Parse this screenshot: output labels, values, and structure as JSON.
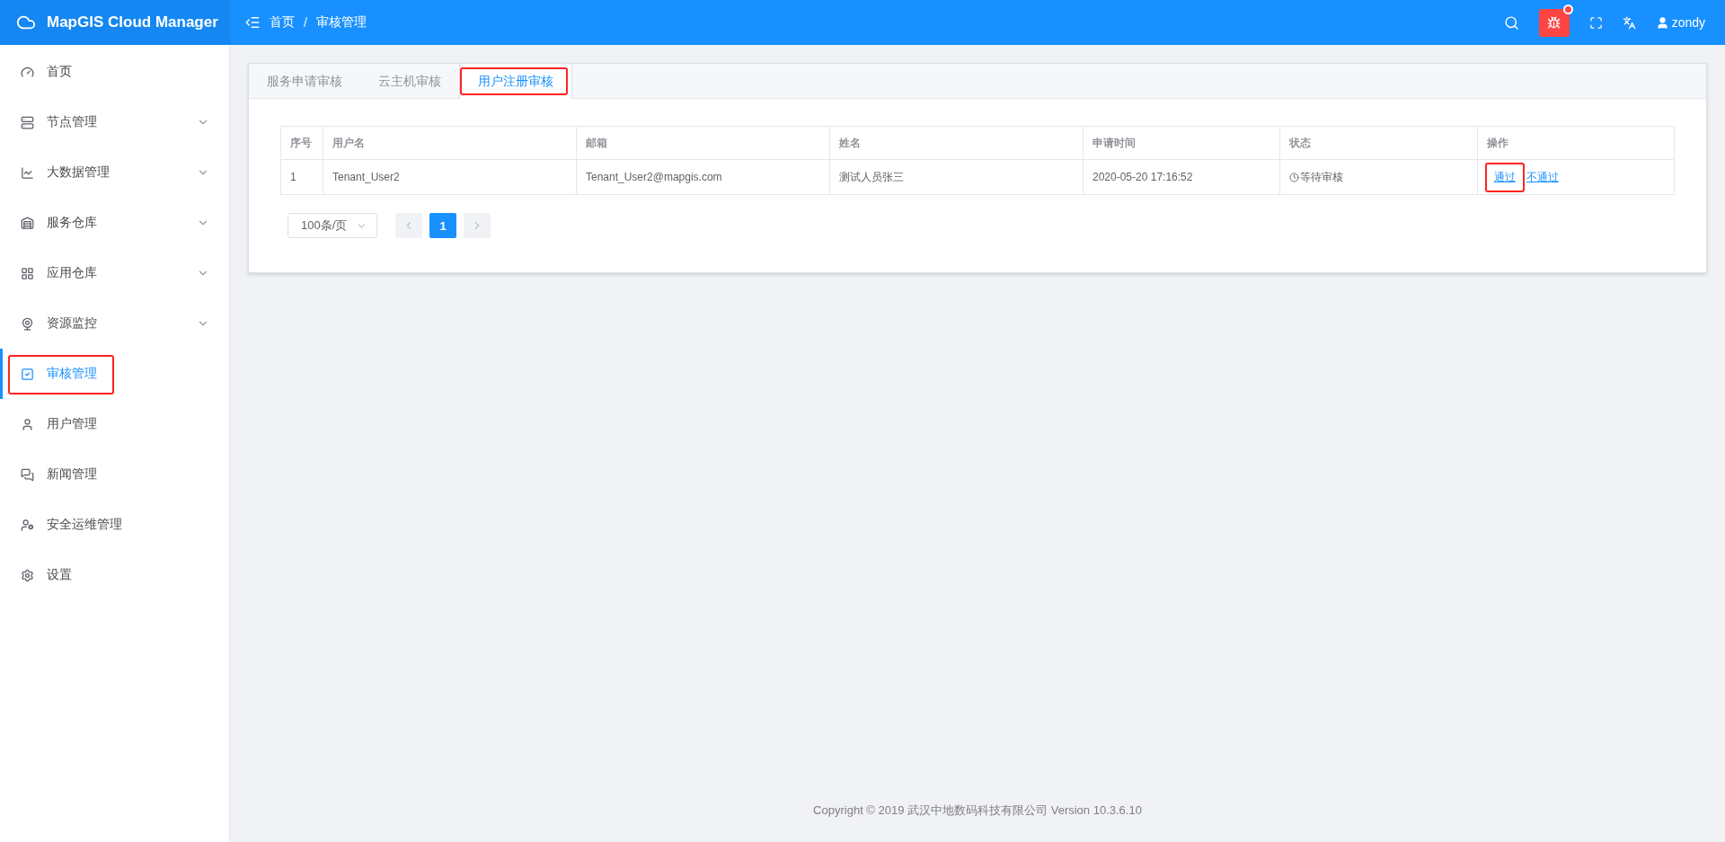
{
  "header": {
    "logo": "MapGIS Cloud Manager",
    "breadcrumb": [
      "首页",
      "审核管理"
    ],
    "separator": "/",
    "user": "zondy",
    "bug_badge": true
  },
  "sidebar": {
    "items": [
      {
        "label": "首页",
        "expandable": false,
        "selected": false,
        "highlighted": false
      },
      {
        "label": "节点管理",
        "expandable": true,
        "selected": false,
        "highlighted": false
      },
      {
        "label": "大数据管理",
        "expandable": true,
        "selected": false,
        "highlighted": false
      },
      {
        "label": "服务仓库",
        "expandable": true,
        "selected": false,
        "highlighted": false
      },
      {
        "label": "应用仓库",
        "expandable": true,
        "selected": false,
        "highlighted": false
      },
      {
        "label": "资源监控",
        "expandable": true,
        "selected": false,
        "highlighted": false
      },
      {
        "label": "审核管理",
        "expandable": false,
        "selected": true,
        "highlighted": true
      },
      {
        "label": "用户管理",
        "expandable": false,
        "selected": false,
        "highlighted": false
      },
      {
        "label": "新闻管理",
        "expandable": false,
        "selected": false,
        "highlighted": false
      },
      {
        "label": "安全运维管理",
        "expandable": false,
        "selected": false,
        "highlighted": false
      },
      {
        "label": "设置",
        "expandable": false,
        "selected": false,
        "highlighted": false
      }
    ]
  },
  "tabs": [
    {
      "label": "服务申请审核",
      "selected": false,
      "highlighted": false
    },
    {
      "label": "云主机审核",
      "selected": false,
      "highlighted": false
    },
    {
      "label": "用户注册审核",
      "selected": true,
      "highlighted": true
    }
  ],
  "table": {
    "columns": [
      "序号",
      "用户名",
      "邮箱",
      "姓名",
      "申请时间",
      "状态",
      "操作"
    ],
    "rows": [
      {
        "index": "1",
        "username": "Tenant_User2",
        "email": "Tenant_User2@mapgis.com",
        "name": "测试人员张三",
        "time": "2020-05-20 17:16:52",
        "status": "等待审核",
        "actions": [
          {
            "label": "通过",
            "highlighted": true
          },
          {
            "label": "不通过",
            "highlighted": false
          }
        ]
      }
    ]
  },
  "pagination": {
    "page_size": "100条/页",
    "pages": [
      {
        "label": "1",
        "selected": true
      }
    ]
  },
  "footer": "Copyright © 2019 武汉中地数码科技有限公司 Version 10.3.6.10"
}
